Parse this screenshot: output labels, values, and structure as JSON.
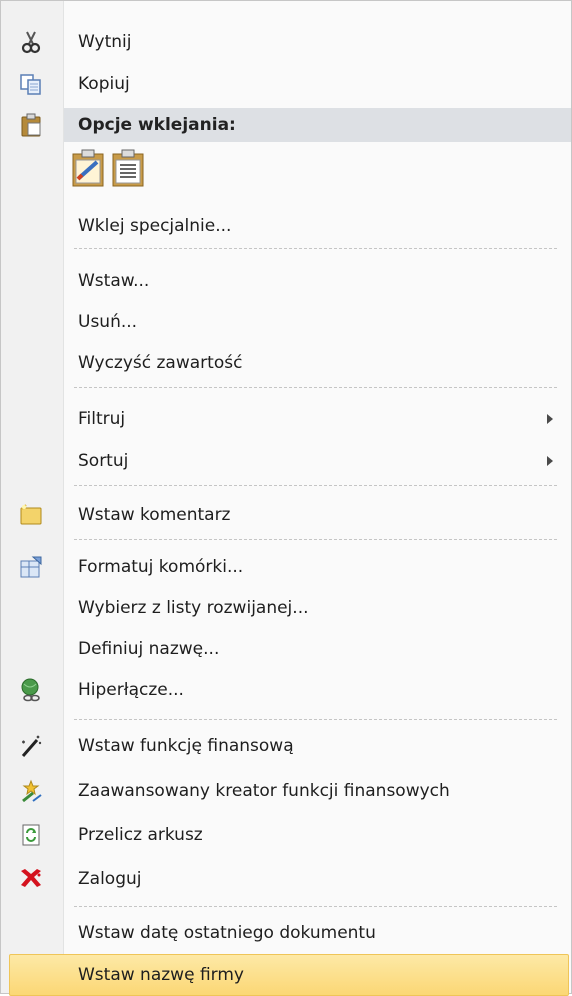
{
  "menu": {
    "items": {
      "cut": {
        "label": "Wytnij",
        "icon": "scissors-icon"
      },
      "copy": {
        "label": "Kopiuj",
        "icon": "copy-icon"
      },
      "paste_header": {
        "label": "Opcje wklejania:",
        "icon": "paste-clipboard-icon"
      },
      "paste_options": [
        {
          "icon": "paste-formatting-icon"
        },
        {
          "icon": "paste-values-icon"
        }
      ],
      "paste_special": {
        "label": "Wklej specjalnie..."
      },
      "insert": {
        "label": "Wstaw..."
      },
      "delete": {
        "label": "Usuń..."
      },
      "clear": {
        "label": "Wyczyść zawartość"
      },
      "filter": {
        "label": "Filtruj",
        "submenu": true
      },
      "sort": {
        "label": "Sortuj",
        "submenu": true
      },
      "insert_comment": {
        "label": "Wstaw komentarz",
        "icon": "comment-icon"
      },
      "format_cells": {
        "label": "Formatuj komórki...",
        "icon": "format-cells-icon"
      },
      "pick_list": {
        "label": "Wybierz z listy rozwijanej..."
      },
      "define_name": {
        "label": "Definiuj nazwę..."
      },
      "hyperlink": {
        "label": "Hiperłącze...",
        "icon": "hyperlink-globe-icon"
      },
      "insert_fin_func": {
        "label": "Wstaw funkcję finansową",
        "icon": "magic-wand-icon"
      },
      "advanced_wizard": {
        "label": "Zaawansowany kreator funkcji finansowych",
        "icon": "wizard-icon"
      },
      "recalc": {
        "label": "Przelicz arkusz",
        "icon": "recalculate-icon"
      },
      "login": {
        "label": "Zaloguj",
        "icon": "login-logo-icon"
      },
      "insert_last_date": {
        "label": "Wstaw datę ostatniego dokumentu"
      },
      "insert_company": {
        "label": "Wstaw nazwę firmy"
      }
    },
    "colors": {
      "highlight": "#fbd775",
      "gutter": "#f1f1f1",
      "header_bg": "#dde0e4"
    }
  }
}
